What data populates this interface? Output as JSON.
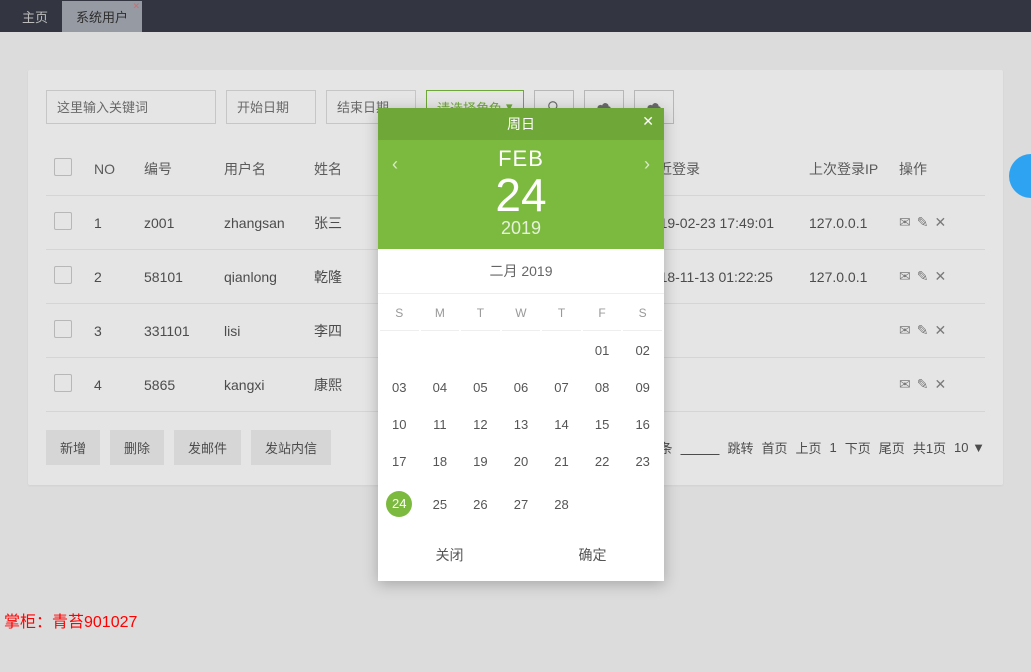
{
  "tabs": {
    "home": "主页",
    "active": "系统用户"
  },
  "toolbar": {
    "kw_placeholder": "这里输入关键词",
    "start_placeholder": "开始日期",
    "end_placeholder": "结束日期",
    "role_label": "请选择角色"
  },
  "table": {
    "headers": {
      "no": "NO",
      "code": "编号",
      "user": "用户名",
      "name": "姓名",
      "last_login": "最近登录",
      "last_ip": "上次登录IP",
      "ops": "操作"
    },
    "rows": [
      {
        "no": "1",
        "code": "z001",
        "user": "zhangsan",
        "name": "张三",
        "last_login": "2019-02-23 17:49:01",
        "last_ip": "127.0.0.1"
      },
      {
        "no": "2",
        "code": "58101",
        "user": "qianlong",
        "name": "乾隆",
        "last_login": "2018-11-13 01:22:25",
        "last_ip": "127.0.0.1"
      },
      {
        "no": "3",
        "code": "331101",
        "user": "lisi",
        "name": "李四",
        "last_login": "",
        "last_ip": ""
      },
      {
        "no": "4",
        "code": "5865",
        "user": "kangxi",
        "name": "康熙",
        "last_login": "",
        "last_ip": ""
      }
    ]
  },
  "footer": {
    "add": "新增",
    "del": "删除",
    "mail": "发邮件",
    "msg": "发站内信",
    "entries_suffix": "条",
    "jump": "跳转",
    "first": "首页",
    "prev": "上页",
    "page": "1",
    "next": "下页",
    "last": "尾页",
    "pages": "共1页",
    "size": "10 ▼"
  },
  "picker": {
    "title": "周日",
    "month_abbr": "FEB",
    "day_num": "24",
    "year": "2019",
    "sub": "二月 2019",
    "dow": [
      "S",
      "M",
      "T",
      "W",
      "T",
      "F",
      "S"
    ],
    "weeks": [
      [
        "",
        "",
        "",
        "",
        "",
        "01",
        "02"
      ],
      [
        "03",
        "04",
        "05",
        "06",
        "07",
        "08",
        "09"
      ],
      [
        "10",
        "11",
        "12",
        "13",
        "14",
        "15",
        "16"
      ],
      [
        "17",
        "18",
        "19",
        "20",
        "21",
        "22",
        "23"
      ],
      [
        "24",
        "25",
        "26",
        "27",
        "28",
        "",
        ""
      ]
    ],
    "selected": "24",
    "close": "关闭",
    "ok": "确定"
  },
  "watermark": "掌柜：青苔901027"
}
